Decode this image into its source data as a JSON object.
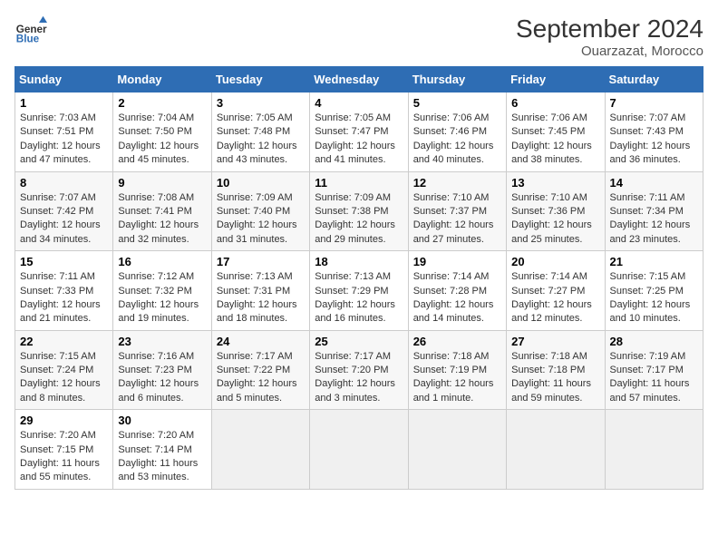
{
  "header": {
    "logo_line1": "General",
    "logo_line2": "Blue",
    "title": "September 2024",
    "subtitle": "Ouarzazat, Morocco"
  },
  "days_of_week": [
    "Sunday",
    "Monday",
    "Tuesday",
    "Wednesday",
    "Thursday",
    "Friday",
    "Saturday"
  ],
  "weeks": [
    [
      {
        "day": "1",
        "sunrise": "7:03 AM",
        "sunset": "7:51 PM",
        "daylight": "12 hours and 47 minutes."
      },
      {
        "day": "2",
        "sunrise": "7:04 AM",
        "sunset": "7:50 PM",
        "daylight": "12 hours and 45 minutes."
      },
      {
        "day": "3",
        "sunrise": "7:05 AM",
        "sunset": "7:48 PM",
        "daylight": "12 hours and 43 minutes."
      },
      {
        "day": "4",
        "sunrise": "7:05 AM",
        "sunset": "7:47 PM",
        "daylight": "12 hours and 41 minutes."
      },
      {
        "day": "5",
        "sunrise": "7:06 AM",
        "sunset": "7:46 PM",
        "daylight": "12 hours and 40 minutes."
      },
      {
        "day": "6",
        "sunrise": "7:06 AM",
        "sunset": "7:45 PM",
        "daylight": "12 hours and 38 minutes."
      },
      {
        "day": "7",
        "sunrise": "7:07 AM",
        "sunset": "7:43 PM",
        "daylight": "12 hours and 36 minutes."
      }
    ],
    [
      {
        "day": "8",
        "sunrise": "7:07 AM",
        "sunset": "7:42 PM",
        "daylight": "12 hours and 34 minutes."
      },
      {
        "day": "9",
        "sunrise": "7:08 AM",
        "sunset": "7:41 PM",
        "daylight": "12 hours and 32 minutes."
      },
      {
        "day": "10",
        "sunrise": "7:09 AM",
        "sunset": "7:40 PM",
        "daylight": "12 hours and 31 minutes."
      },
      {
        "day": "11",
        "sunrise": "7:09 AM",
        "sunset": "7:38 PM",
        "daylight": "12 hours and 29 minutes."
      },
      {
        "day": "12",
        "sunrise": "7:10 AM",
        "sunset": "7:37 PM",
        "daylight": "12 hours and 27 minutes."
      },
      {
        "day": "13",
        "sunrise": "7:10 AM",
        "sunset": "7:36 PM",
        "daylight": "12 hours and 25 minutes."
      },
      {
        "day": "14",
        "sunrise": "7:11 AM",
        "sunset": "7:34 PM",
        "daylight": "12 hours and 23 minutes."
      }
    ],
    [
      {
        "day": "15",
        "sunrise": "7:11 AM",
        "sunset": "7:33 PM",
        "daylight": "12 hours and 21 minutes."
      },
      {
        "day": "16",
        "sunrise": "7:12 AM",
        "sunset": "7:32 PM",
        "daylight": "12 hours and 19 minutes."
      },
      {
        "day": "17",
        "sunrise": "7:13 AM",
        "sunset": "7:31 PM",
        "daylight": "12 hours and 18 minutes."
      },
      {
        "day": "18",
        "sunrise": "7:13 AM",
        "sunset": "7:29 PM",
        "daylight": "12 hours and 16 minutes."
      },
      {
        "day": "19",
        "sunrise": "7:14 AM",
        "sunset": "7:28 PM",
        "daylight": "12 hours and 14 minutes."
      },
      {
        "day": "20",
        "sunrise": "7:14 AM",
        "sunset": "7:27 PM",
        "daylight": "12 hours and 12 minutes."
      },
      {
        "day": "21",
        "sunrise": "7:15 AM",
        "sunset": "7:25 PM",
        "daylight": "12 hours and 10 minutes."
      }
    ],
    [
      {
        "day": "22",
        "sunrise": "7:15 AM",
        "sunset": "7:24 PM",
        "daylight": "12 hours and 8 minutes."
      },
      {
        "day": "23",
        "sunrise": "7:16 AM",
        "sunset": "7:23 PM",
        "daylight": "12 hours and 6 minutes."
      },
      {
        "day": "24",
        "sunrise": "7:17 AM",
        "sunset": "7:22 PM",
        "daylight": "12 hours and 5 minutes."
      },
      {
        "day": "25",
        "sunrise": "7:17 AM",
        "sunset": "7:20 PM",
        "daylight": "12 hours and 3 minutes."
      },
      {
        "day": "26",
        "sunrise": "7:18 AM",
        "sunset": "7:19 PM",
        "daylight": "12 hours and 1 minute."
      },
      {
        "day": "27",
        "sunrise": "7:18 AM",
        "sunset": "7:18 PM",
        "daylight": "11 hours and 59 minutes."
      },
      {
        "day": "28",
        "sunrise": "7:19 AM",
        "sunset": "7:17 PM",
        "daylight": "11 hours and 57 minutes."
      }
    ],
    [
      {
        "day": "29",
        "sunrise": "7:20 AM",
        "sunset": "7:15 PM",
        "daylight": "11 hours and 55 minutes."
      },
      {
        "day": "30",
        "sunrise": "7:20 AM",
        "sunset": "7:14 PM",
        "daylight": "11 hours and 53 minutes."
      },
      null,
      null,
      null,
      null,
      null
    ]
  ],
  "labels": {
    "sunrise": "Sunrise:",
    "sunset": "Sunset:",
    "daylight": "Daylight:"
  }
}
